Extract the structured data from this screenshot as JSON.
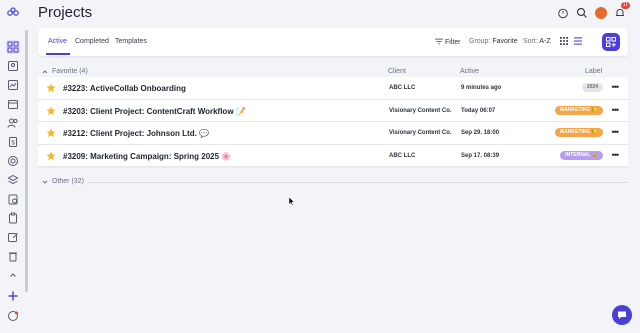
{
  "page": {
    "title": "Projects"
  },
  "header": {
    "notification_count": "11"
  },
  "tabs": [
    {
      "label": "Active"
    },
    {
      "label": "Completed"
    },
    {
      "label": "Templates"
    }
  ],
  "toolbar": {
    "filter_label": "Filter",
    "group_label": "Group:",
    "group_value": "Favorite",
    "sort_label": "Sort:",
    "sort_value": "A-Z"
  },
  "columns": {
    "client": "Client",
    "active": "Active",
    "label": "Label"
  },
  "groups": {
    "favorite": {
      "label": "Favorite (4)"
    },
    "other": {
      "label": "Other (32)"
    }
  },
  "projects": [
    {
      "name": "#3223: ActiveCollab Onboarding",
      "client": "ABC LLC",
      "active": "9 minutes ago",
      "label": "2024",
      "label_color": "#e4e5e8",
      "label_text_color": "#6b7080"
    },
    {
      "name": "#3203: Client Project: ContentCraft Workflow 📝",
      "client": "Visionary Content Co.",
      "active": "Today 06:07",
      "label": "MARKETING 🍋",
      "label_color": "#f3a54a",
      "label_text_color": "#ffffff"
    },
    {
      "name": "#3212: Client Project: Johnson Ltd. 💬",
      "client": "Visionary Content Co.",
      "active": "Sep 29. 18:00",
      "label": "MARKETING 🍋",
      "label_color": "#f3a54a",
      "label_text_color": "#ffffff"
    },
    {
      "name": "#3209: Marketing Campaign: Spring 2025 🌸",
      "client": "ABC LLC",
      "active": "Sep 17. 08:39",
      "label": "INTERNAL 🔒",
      "label_color": "#b89cf0",
      "label_text_color": "#ffffff"
    }
  ],
  "colors": {
    "accent": "#4b3fd6",
    "star": "#f5b82e"
  }
}
